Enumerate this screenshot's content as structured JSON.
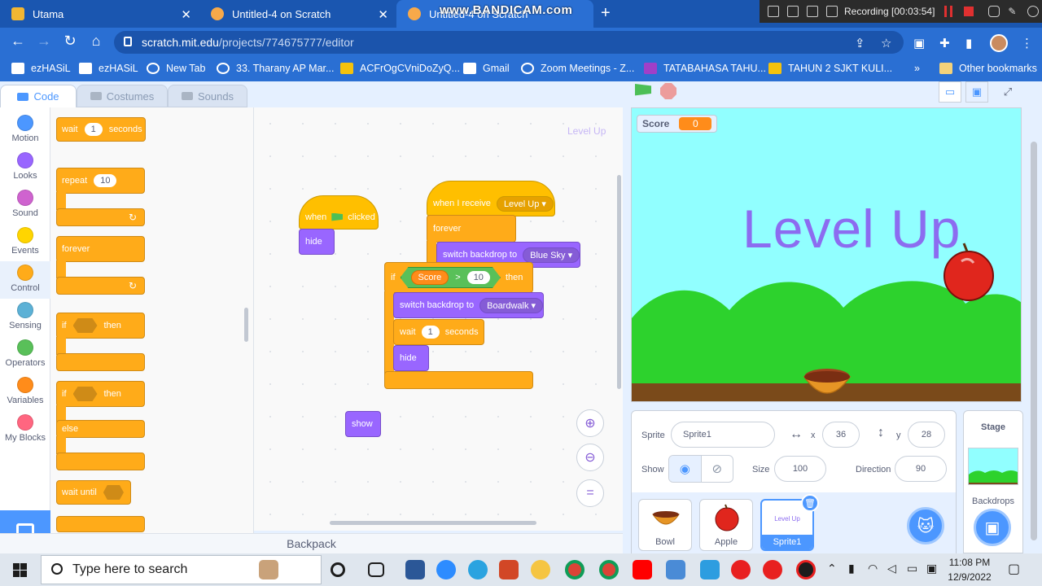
{
  "browser": {
    "tabs": [
      {
        "label": "Utama"
      },
      {
        "label": "Untitled-4 on Scratch"
      },
      {
        "label": "Untitled-4 on Scratch"
      }
    ],
    "watermark": "www.BANDICAM.com",
    "recording": "Recording [00:03:54]",
    "url_host": "scratch.mit.edu",
    "url_path": "/projects/774675777/editor",
    "bookmarks": [
      "ezHASiL",
      "ezHASiL",
      "New Tab",
      "33. Tharany AP Mar...",
      "ACFrOgCVniDoZyQ...",
      "Gmail",
      "Zoom Meetings - Z...",
      "TATABAHASA TAHU...",
      "TAHUN 2 SJKT KULI...",
      "Other bookmarks"
    ]
  },
  "editor": {
    "tabs": {
      "code": "Code",
      "costumes": "Costumes",
      "sounds": "Sounds"
    },
    "categories": [
      {
        "label": "Motion",
        "color": "#4c97ff"
      },
      {
        "label": "Looks",
        "color": "#9966ff"
      },
      {
        "label": "Sound",
        "color": "#cf63cf"
      },
      {
        "label": "Events",
        "color": "#ffd500"
      },
      {
        "label": "Control",
        "color": "#ffab19"
      },
      {
        "label": "Sensing",
        "color": "#5cb1d6"
      },
      {
        "label": "Operators",
        "color": "#59c059"
      },
      {
        "label": "Variables",
        "color": "#ff8c1a"
      },
      {
        "label": "My Blocks",
        "color": "#ff6680"
      }
    ],
    "palette": {
      "wait": "wait",
      "wait_value": "1",
      "seconds": "seconds",
      "repeat": "repeat",
      "repeat_value": "10",
      "forever": "forever",
      "if": "if",
      "then": "then",
      "else": "else",
      "wait_until": "wait until"
    },
    "workspace": {
      "hint": "Level Up",
      "when": "when",
      "clicked": "clicked",
      "hide": "hide",
      "show": "show",
      "when_i_receive": "when I receive",
      "message": "Level Up",
      "forever": "forever",
      "switch_backdrop_to": "switch backdrop to",
      "backdrop1": "Blue Sky",
      "backdrop2": "Boardwalk",
      "if": "if",
      "then": "then",
      "var": "Score",
      "op": ">",
      "compare": "10",
      "wait": "wait",
      "wait_value": "1",
      "seconds": "seconds"
    },
    "backpack": "Backpack"
  },
  "stage": {
    "monitor_label": "Score",
    "monitor_value": "0",
    "level_text": "Level Up"
  },
  "sprite_info": {
    "sprite_label": "Sprite",
    "sprite_name": "Sprite1",
    "x_label": "x",
    "x": "36",
    "y_label": "y",
    "y": "28",
    "show_label": "Show",
    "size_label": "Size",
    "size": "100",
    "direction_label": "Direction",
    "direction": "90"
  },
  "sprites": [
    {
      "name": "Bowl"
    },
    {
      "name": "Apple"
    },
    {
      "name": "Sprite1",
      "costume_text": "Level Up"
    }
  ],
  "stage_pane": {
    "title": "Stage",
    "backdrops": "Backdrops"
  },
  "taskbar": {
    "search_placeholder": "Type here to search",
    "time": "11:08 PM",
    "date": "12/9/2022"
  }
}
